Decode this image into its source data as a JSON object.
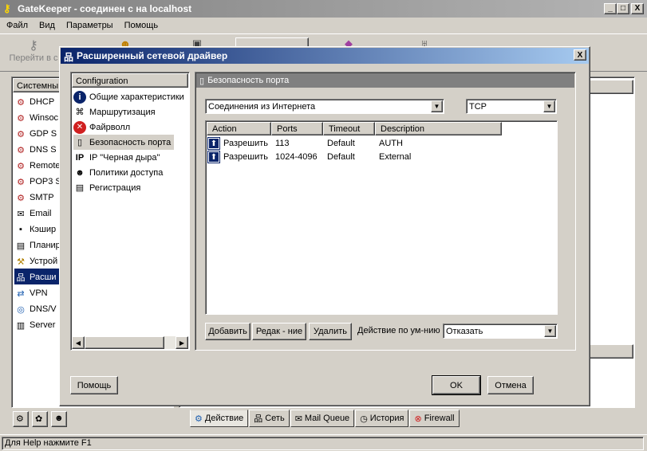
{
  "window": {
    "title": "GateKeeper - соединен с на localhost",
    "min": "_",
    "max": "□",
    "close": "X"
  },
  "menu": [
    "Файл",
    "Вид",
    "Параметры",
    "Помощь"
  ],
  "toolbar": {
    "first_label": "Перейти в с"
  },
  "left_panel": {
    "header": "Системны",
    "items": [
      "DHCP",
      "Winsoc",
      "GDP S",
      "DNS S",
      "Remote",
      "POP3 S",
      "SMTP",
      "Email",
      "Кэшир",
      "Планир",
      "Устрой",
      "Расши",
      "VPN",
      "DNS/V",
      "Server"
    ]
  },
  "bottom_tabs": [
    "Действие",
    "Сеть",
    "Mail Queue",
    "История",
    "Firewall"
  ],
  "status": "Для Help нажмите F1",
  "dialog": {
    "title": "Расширенный сетевой драйвер",
    "close": "X",
    "tree": {
      "header": "Configuration",
      "items": [
        {
          "label": "Общие характеристики",
          "icon": "info-icon"
        },
        {
          "label": "Маршрутизация",
          "icon": "routing-icon"
        },
        {
          "label": "Файрволл",
          "icon": "firewall-icon"
        },
        {
          "label": "Безопасность порта",
          "icon": "port-icon"
        },
        {
          "label": "IP \"Черная дыра\"",
          "icon": "ip-icon"
        },
        {
          "label": "Политики доступа",
          "icon": "user-icon"
        },
        {
          "label": "Регистрация",
          "icon": "document-icon"
        }
      ],
      "selected_index": 3
    },
    "section_title": "Безопасность порта",
    "connection_select": "Соединения из Интернета",
    "protocol_select": "TCP",
    "table": {
      "columns": [
        "Action",
        "Ports",
        "Timeout",
        "Description"
      ],
      "rows": [
        {
          "action": "Разрешить",
          "ports": "113",
          "timeout": "Default",
          "description": "AUTH"
        },
        {
          "action": "Разрешить",
          "ports": "1024-4096",
          "timeout": "Default",
          "description": "External"
        }
      ]
    },
    "buttons": {
      "add": "Добавить",
      "edit": "Редак - ние",
      "delete": "Удалить"
    },
    "default_action_label": "Действие по ум-нию",
    "default_action_value": "Отказать",
    "help": "Помощь",
    "ok": "OK",
    "cancel": "Отмена"
  }
}
